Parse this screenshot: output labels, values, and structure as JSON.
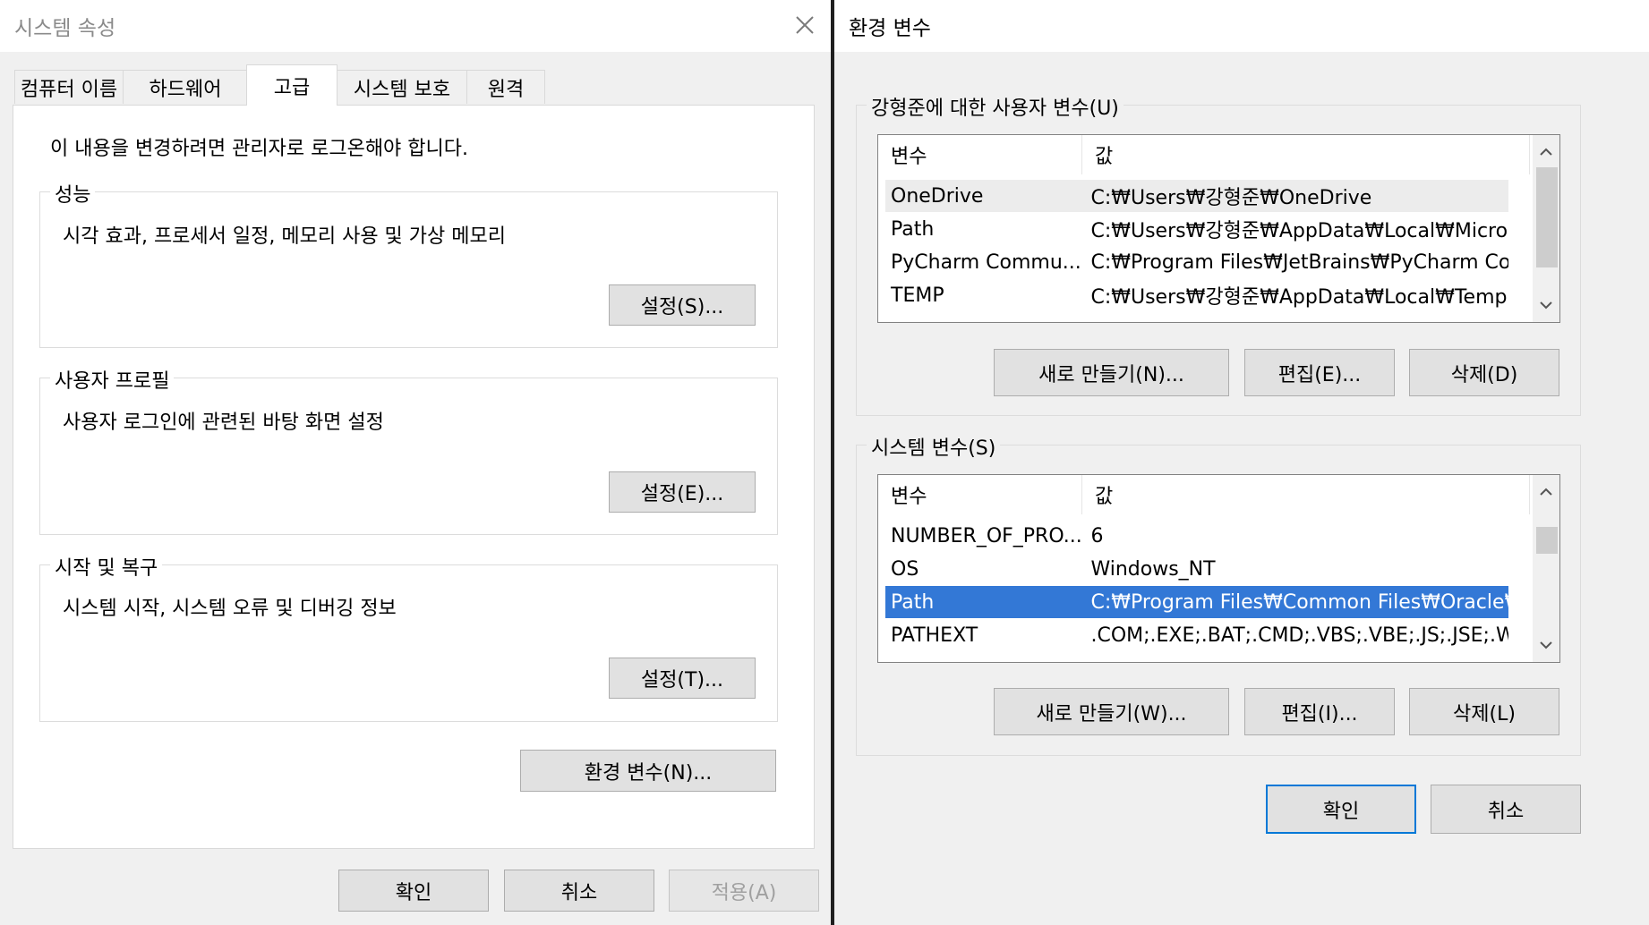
{
  "left": {
    "title": "시스템 속성",
    "tabs": [
      "컴퓨터 이름",
      "하드웨어",
      "고급",
      "시스템 보호",
      "원격"
    ],
    "active_tab_index": 2,
    "admin_note": "이 내용을 변경하려면 관리자로 로그온해야 합니다.",
    "performance": {
      "legend": "성능",
      "desc": "시각 효과, 프로세서 일정, 메모리 사용 및 가상 메모리",
      "button": "설정(S)..."
    },
    "profile": {
      "legend": "사용자 프로필",
      "desc": "사용자 로그인에 관련된 바탕 화면 설정",
      "button": "설정(E)..."
    },
    "startup": {
      "legend": "시작 및 복구",
      "desc": "시스템 시작, 시스템 오류 및 디버깅 정보",
      "button": "설정(T)..."
    },
    "env_button": "환경 변수(N)...",
    "ok": "확인",
    "cancel": "취소",
    "apply": "적용(A)"
  },
  "right": {
    "title": "환경 변수",
    "user_vars": {
      "legend": "강형준에 대한 사용자 변수(U)",
      "headers": [
        "변수",
        "값"
      ],
      "rows": [
        [
          "OneDrive",
          "C:₩Users₩강형준₩OneDrive"
        ],
        [
          "Path",
          "C:₩Users₩강형준₩AppData₩Local₩Micros..."
        ],
        [
          "PyCharm Commu...",
          "C:₩Program Files₩JetBrains₩PyCharm Co..."
        ],
        [
          "TEMP",
          "C:₩Users₩강형준₩AppData₩Local₩Temp"
        ]
      ],
      "buttons": [
        "새로 만들기(N)...",
        "편집(E)...",
        "삭제(D)"
      ]
    },
    "system_vars": {
      "legend": "시스템 변수(S)",
      "headers": [
        "변수",
        "값"
      ],
      "rows": [
        [
          "NUMBER_OF_PRO...",
          "6"
        ],
        [
          "OS",
          "Windows_NT"
        ],
        [
          "Path",
          "C:₩Program Files₩Common Files₩Oracle₩..."
        ],
        [
          "PATHEXT",
          ".COM;.EXE;.BAT;.CMD;.VBS;.VBE;.JS;.JSE;.W..."
        ]
      ],
      "selected_row": 2,
      "buttons": [
        "새로 만들기(W)...",
        "편집(I)...",
        "삭제(L)"
      ]
    },
    "ok": "확인",
    "cancel": "취소"
  },
  "colors": {
    "selection": "#3378d6",
    "default_button_border": "#0078d7"
  }
}
